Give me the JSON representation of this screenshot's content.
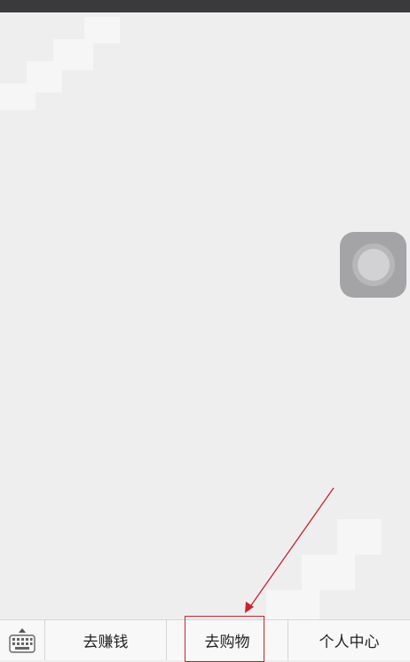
{
  "app": {
    "colors": {
      "background": "#efeeef",
      "status_bar": "#3a3a3c",
      "annotation": "#c8242b",
      "menu_text": "#222222"
    }
  },
  "bottom_menu": {
    "keyboard_icon": "keyboard-icon",
    "items": [
      {
        "label": "去赚钱"
      },
      {
        "label": "去购物"
      },
      {
        "label": "个人中心"
      }
    ]
  },
  "assistive_touch": {
    "icon": "assistive-touch-icon"
  },
  "annotation": {
    "target": "去购物"
  }
}
